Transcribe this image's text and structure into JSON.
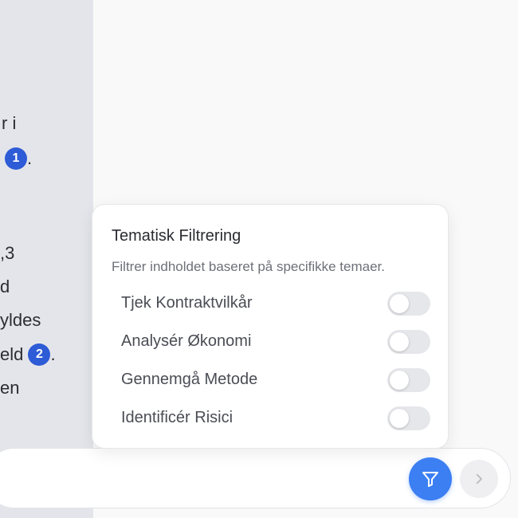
{
  "chat": {
    "lines": [
      {
        "text": "r i",
        "badge": ""
      },
      {
        "text": "",
        "badge": "1",
        "after": "."
      },
      {
        "text": ",3",
        "badge": ""
      },
      {
        "text": "d",
        "badge": ""
      },
      {
        "text": "yldes",
        "badge": ""
      },
      {
        "text": "eld",
        "badge": "2",
        "after": "."
      },
      {
        "text": "en",
        "badge": ""
      }
    ]
  },
  "filter_panel": {
    "title": "Tematisk Filtrering",
    "description": "Filtrer indholdet baseret på specifikke temaer.",
    "options": [
      {
        "label": "Tjek Kontraktvilkår",
        "enabled": false
      },
      {
        "label": "Analysér Økonomi",
        "enabled": false
      },
      {
        "label": "Gennemgå Metode",
        "enabled": false
      },
      {
        "label": "Identificér Risici",
        "enabled": false
      }
    ]
  },
  "input_bar": {
    "filter_icon": "funnel-icon",
    "send_icon": "chevron-right-icon"
  },
  "colors": {
    "accent": "#3b7ff3",
    "citation": "#2e5bd6",
    "toggle_off": "#e6e7ea"
  }
}
